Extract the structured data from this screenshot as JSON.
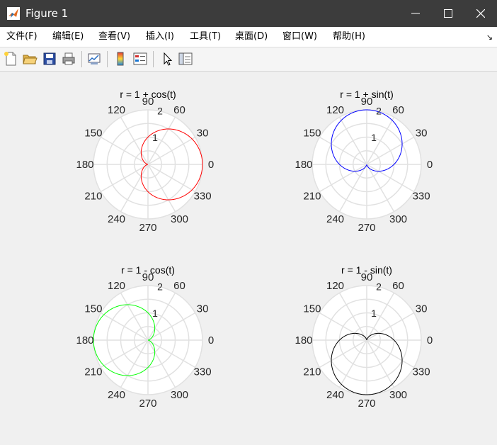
{
  "window": {
    "title": "Figure 1",
    "icon": "matlab-icon",
    "controls": [
      "minimize-icon",
      "maximize-icon",
      "close-icon"
    ]
  },
  "menu": {
    "items": [
      {
        "label": "文件(F)",
        "key": "file"
      },
      {
        "label": "编辑(E)",
        "key": "edit"
      },
      {
        "label": "查看(V)",
        "key": "view"
      },
      {
        "label": "插入(I)",
        "key": "insert"
      },
      {
        "label": "工具(T)",
        "key": "tools"
      },
      {
        "label": "桌面(D)",
        "key": "desktop"
      },
      {
        "label": "窗口(W)",
        "key": "window"
      },
      {
        "label": "帮助(H)",
        "key": "help"
      }
    ],
    "overflow_icon": "overflow-arrow-icon"
  },
  "toolbar": {
    "buttons": [
      {
        "icon": "new-figure-icon"
      },
      {
        "icon": "open-folder-icon"
      },
      {
        "icon": "save-icon"
      },
      {
        "icon": "print-icon"
      },
      {
        "icon": "link-plot-icon"
      },
      {
        "icon": "insert-colorbar-icon"
      },
      {
        "icon": "insert-legend-icon"
      },
      {
        "icon": "edit-plot-arrow-icon"
      },
      {
        "icon": "property-inspector-icon"
      }
    ]
  },
  "chart_data": [
    {
      "type": "line",
      "coordinate": "polar",
      "title": "r = 1 + cos(t)",
      "equation": "1+cos",
      "color": "#ff0000",
      "rlim": [
        0,
        2
      ],
      "rticks": [
        1,
        2
      ],
      "theta_ticks": [
        "0",
        "30",
        "60",
        "90",
        "120",
        "150",
        "180",
        "210",
        "240",
        "270",
        "300",
        "330"
      ],
      "grid": true
    },
    {
      "type": "line",
      "coordinate": "polar",
      "title": "r = 1 + sin(t)",
      "equation": "1+sin",
      "color": "#0000ff",
      "rlim": [
        0,
        2
      ],
      "rticks": [
        1,
        2
      ],
      "theta_ticks": [
        "0",
        "30",
        "60",
        "90",
        "120",
        "150",
        "180",
        "210",
        "240",
        "270",
        "300",
        "330"
      ],
      "grid": true
    },
    {
      "type": "line",
      "coordinate": "polar",
      "title": "r = 1 - cos(t)",
      "equation": "1-cos",
      "color": "#00ff00",
      "rlim": [
        0,
        2
      ],
      "rticks": [
        1,
        2
      ],
      "theta_ticks": [
        "0",
        "30",
        "60",
        "90",
        "120",
        "150",
        "180",
        "210",
        "240",
        "270",
        "300",
        "330"
      ],
      "grid": true
    },
    {
      "type": "line",
      "coordinate": "polar",
      "title": "r = 1 - sin(t)",
      "equation": "1-sin",
      "color": "#000000",
      "rlim": [
        0,
        2
      ],
      "rticks": [
        1,
        2
      ],
      "theta_ticks": [
        "0",
        "30",
        "60",
        "90",
        "120",
        "150",
        "180",
        "210",
        "240",
        "270",
        "300",
        "330"
      ],
      "grid": true
    }
  ]
}
